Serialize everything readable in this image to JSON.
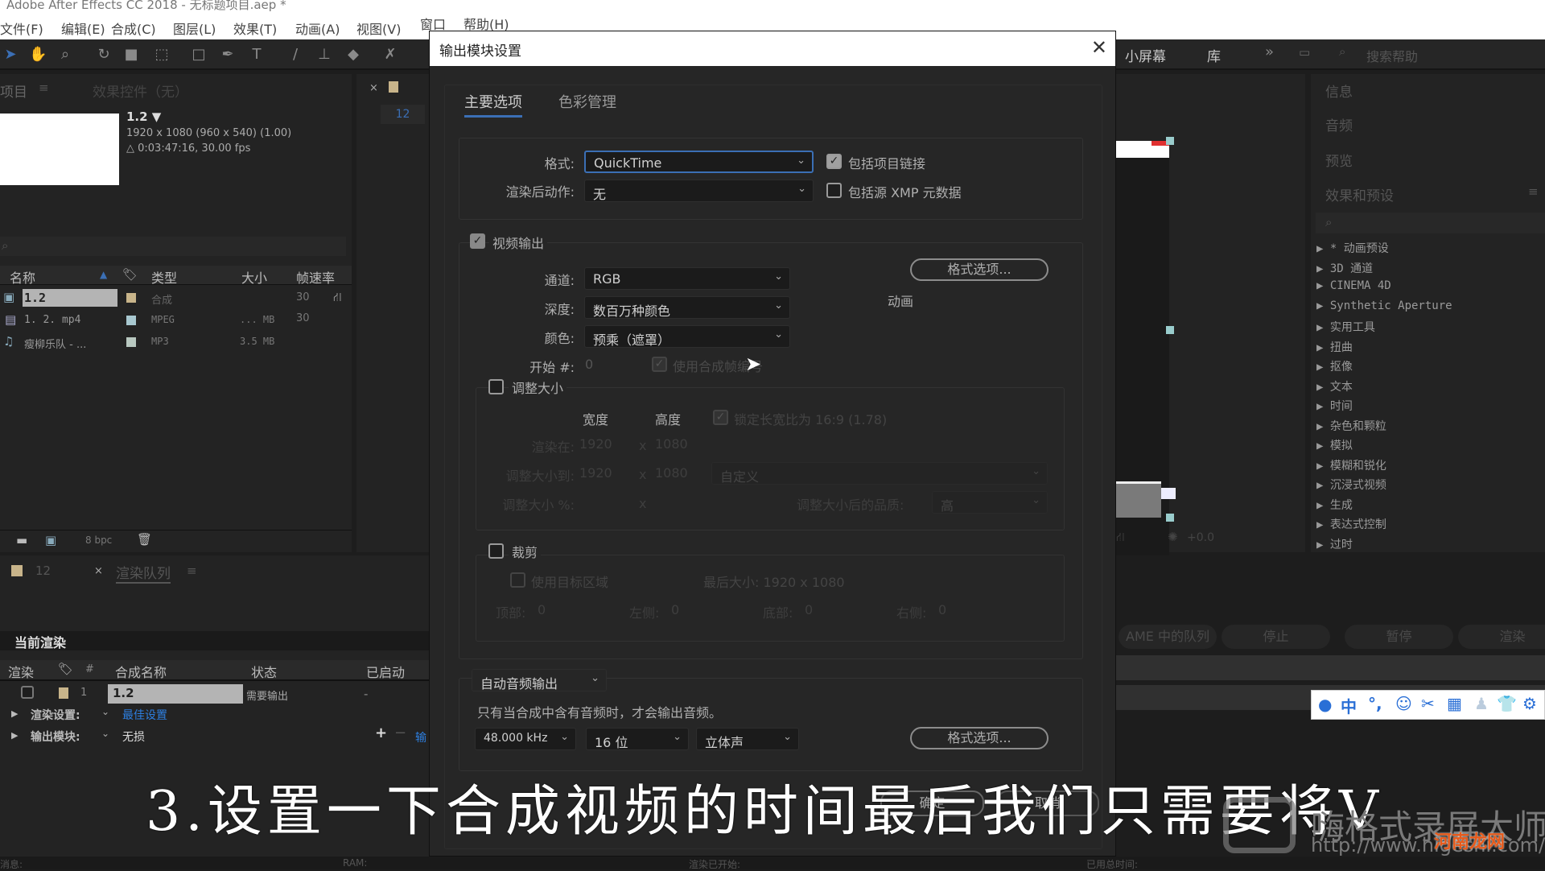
{
  "app": {
    "title": "Adobe After Effects CC 2018 - 无标题项目.aep *",
    "menu": [
      "文件(F)",
      "编辑(E)",
      "合成(C)",
      "图层(L)",
      "效果(T)",
      "动画(A)",
      "视图(V)",
      "窗口",
      "帮助(H)"
    ]
  },
  "workspace": {
    "items": [
      "小屏幕",
      "库",
      "»"
    ],
    "search_placeholder": "搜索帮助"
  },
  "project": {
    "tab_project": "项目",
    "tab_effects": "效果控件（无）",
    "comp_name": "1.2 ▼",
    "comp_size": "1920 x 1080  (960 x 540) (1.00)",
    "comp_duration": "△ 0:03:47:16, 30.00 fps",
    "columns": [
      "名称",
      "类型",
      "大小",
      "帧速率"
    ],
    "rows": [
      {
        "name": "1.2",
        "type": "合成",
        "size": "",
        "fps": "30",
        "color": "#c8b48a"
      },
      {
        "name": "1. 2. mp4",
        "type": "MPEG",
        "size": "... MB",
        "fps": "30",
        "color": "#a8c8d0"
      },
      {
        "name": "瘦柳乐队 - ...",
        "type": "MP3",
        "size": "3.5 MB",
        "fps": "",
        "color": "#b8c8c0"
      }
    ],
    "bpc": "8 bpc"
  },
  "comp_panel": {
    "tab": "12"
  },
  "render_queue": {
    "comp_tab": "12",
    "tab": "渲染队列",
    "current_render": "当前渲染",
    "columns": [
      "渲染",
      "#",
      "合成名称",
      "状态",
      "已启动"
    ],
    "row": {
      "num": "1",
      "comp": "1.2",
      "status": "需要输出",
      "started": "-"
    },
    "render_settings_label": "渲染设置:",
    "render_settings_value": "最佳设置",
    "output_module_label": "输出模块:",
    "output_module_value": "无损",
    "output_to": "输",
    "buttons": [
      "AME 中的队列",
      "停止",
      "暂停",
      "渲染"
    ]
  },
  "right_panels": {
    "items": [
      "信息",
      "音频",
      "预览",
      "效果和预设"
    ],
    "effects": [
      "* 动画预设",
      "3D 通道",
      "CINEMA 4D",
      "Synthetic Aperture",
      "实用工具",
      "扭曲",
      "抠像",
      "文本",
      "时间",
      "杂色和颗粒",
      "模拟",
      "模糊和锐化",
      "沉浸式视频",
      "生成",
      "表达式控制",
      "过时"
    ]
  },
  "viewer": {
    "exposure": "+0.0"
  },
  "dialog": {
    "title": "输出模块设置",
    "tabs": [
      "主要选项",
      "色彩管理"
    ],
    "format_label": "格式:",
    "format_value": "QuickTime",
    "post_render_label": "渲染后动作:",
    "post_render_value": "无",
    "include_project_link": "包括项目链接",
    "include_project_link_checked": true,
    "include_xmp": "包括源 XMP 元数据",
    "include_xmp_checked": false,
    "video_output": "视频输出",
    "video_output_checked": true,
    "channels_label": "通道:",
    "channels_value": "RGB",
    "depth_label": "深度:",
    "depth_value": "数百万种颜色",
    "color_label": "颜色:",
    "color_value": "预乘（遮罩）",
    "start_label": "开始 #:",
    "start_value": "0",
    "use_comp_frame": "使用合成帧编号",
    "use_comp_frame_checked": true,
    "format_options": "格式选项...",
    "codec": "动画",
    "resize": "调整大小",
    "resize_checked": false,
    "width_label": "宽度",
    "height_label": "高度",
    "lock_aspect": "锁定长宽比为 16:9 (1.78)",
    "rendering_at_label": "渲染在:",
    "rendering_w": "1920",
    "rendering_h": "1080",
    "resize_to_label": "调整大小到:",
    "resize_w": "1920",
    "resize_h": "1080",
    "resize_preset": "自定义",
    "resize_pct_label": "调整大小 %:",
    "x": "x",
    "quality_label": "调整大小后的品质:",
    "quality_value": "高",
    "crop": "裁剪",
    "crop_checked": false,
    "use_roi": "使用目标区域",
    "final_size": "最后大小: 1920 x 1080",
    "top_label": "顶部:",
    "top": "0",
    "left_label": "左侧:",
    "left": "0",
    "bottom_label": "底部:",
    "bottom": "0",
    "right_label": "右侧:",
    "right": "0",
    "audio_mode": "自动音频输出",
    "audio_note": "只有当合成中含有音频时，才会输出音频。",
    "sample_rate": "48.000 kHz",
    "bit_depth": "16 位",
    "channels_audio": "立体声",
    "audio_format_options": "格式选项...",
    "ok": "确定",
    "cancel": "取消"
  },
  "status_bar": [
    "消息:",
    "RAM:",
    "渲染已开始:",
    "已用总时间:"
  ],
  "subtitle": "3.设置一下合成视频的时间最后我们只需要将V",
  "watermark": {
    "brand": "嗨格式录屏大师",
    "url": "http://www.higeshi.com/",
    "site": "河南龙网"
  },
  "ime_toolbar": {
    "mode": "中",
    "punct": "°,"
  },
  "colors": {
    "accent": "#3b6fb5",
    "link": "#2d7fe0",
    "bg": "#232323"
  }
}
